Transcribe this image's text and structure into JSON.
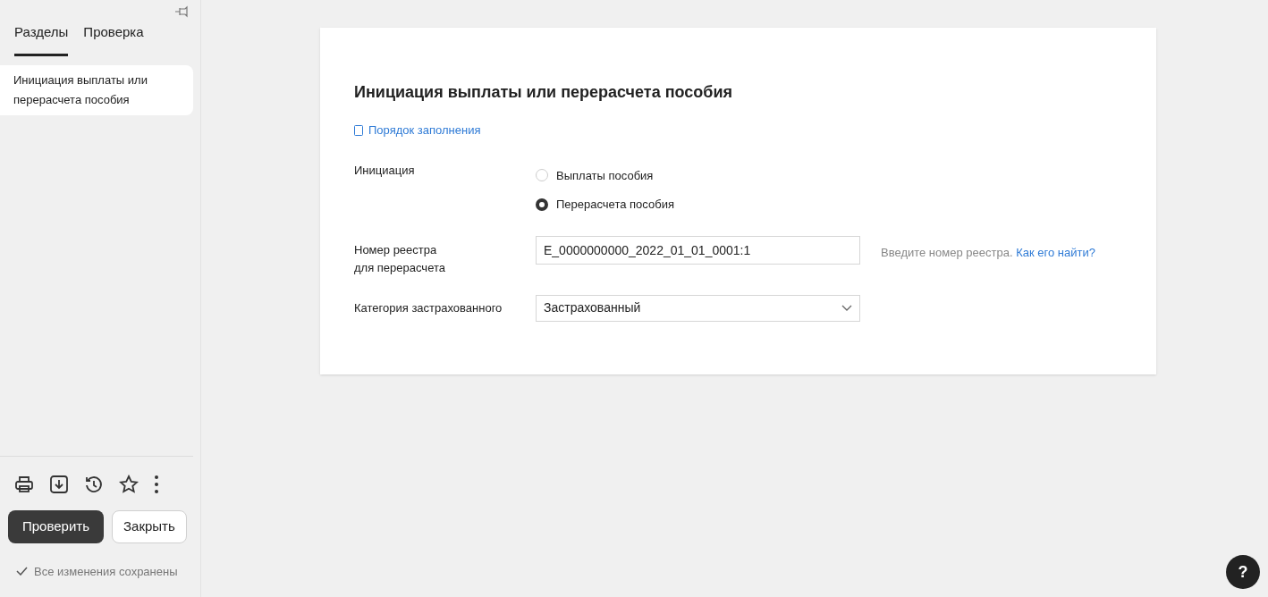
{
  "sidebar": {
    "tabs": [
      {
        "label": "Разделы",
        "selected": true
      },
      {
        "label": "Проверка",
        "selected": false
      }
    ],
    "items": [
      {
        "label": "Инициация выплаты или перерасчета пособия",
        "selected": true
      }
    ],
    "buttons": [
      {
        "label": "Проверить",
        "kind": "primary"
      },
      {
        "label": "Закрыть",
        "kind": "secondary"
      }
    ],
    "status": "Все изменения сохранены"
  },
  "form": {
    "title": "Инициация выплаты или перерасчета пособия",
    "help_link": "Порядок заполнения",
    "initiation": {
      "label": "Инициация",
      "options": [
        {
          "label": "Выплаты пособия",
          "selected": false
        },
        {
          "label": "Перерасчета пособия",
          "selected": true
        }
      ]
    },
    "registry": {
      "label": "Номер реестра\nдля перерасчета",
      "value": "E_0000000000_2022_01_01_0001:1",
      "hint": "Введите номер реестра.",
      "hint_link": "Как его найти?"
    },
    "category": {
      "label": "Категория застрахованного",
      "value": "Застрахованный"
    }
  },
  "help_button": "?"
}
